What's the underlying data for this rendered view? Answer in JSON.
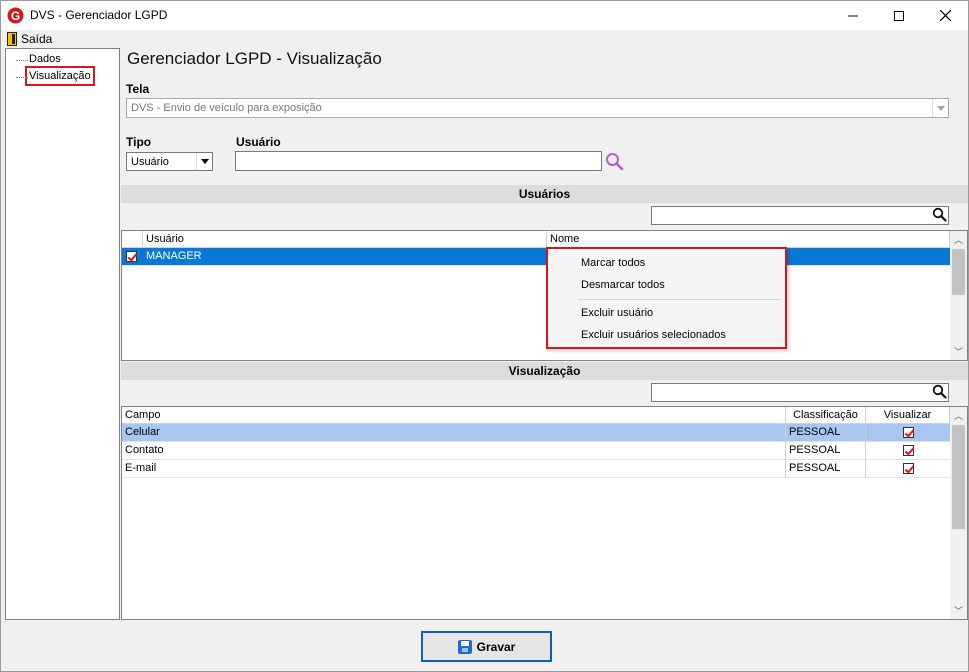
{
  "window": {
    "title": "DVS - Gerenciador LGPD"
  },
  "menu": {
    "exit_label": "Saída"
  },
  "tree": {
    "items": [
      {
        "label": "Dados"
      },
      {
        "label": "Visualização"
      }
    ]
  },
  "page_title": "Gerenciador LGPD - Visualização",
  "tela": {
    "label": "Tela",
    "value": "DVS - Envio de veículo para exposição"
  },
  "tipo": {
    "label": "Tipo",
    "value": "Usuário"
  },
  "usuario_field": {
    "label": "Usuário",
    "value": ""
  },
  "usuarios_section": {
    "title": "Usuários",
    "filter_value": "",
    "columns": [
      "Usuário",
      "Nome"
    ],
    "rows": [
      {
        "checked": true,
        "usuario": "MANAGER",
        "nome": ""
      }
    ]
  },
  "context_menu": {
    "items": [
      "Marcar todos",
      "Desmarcar todos",
      "Excluir usuário",
      "Excluir usuários selecionados"
    ]
  },
  "visualizacao_section": {
    "title": "Visualização",
    "filter_value": "",
    "columns": [
      "Campo",
      "Classificação",
      "Visualizar"
    ],
    "rows": [
      {
        "campo": "Celular",
        "classificacao": "PESSOAL",
        "visualizar": true
      },
      {
        "campo": "Contato",
        "classificacao": "PESSOAL",
        "visualizar": true
      },
      {
        "campo": "E-mail",
        "classificacao": "PESSOAL",
        "visualizar": true
      }
    ]
  },
  "save_button": {
    "label": "Gravar"
  },
  "colors": {
    "accent_red": "#e0141c",
    "selection_blue": "#0a78d7",
    "light_selection": "#a7c6f2"
  }
}
